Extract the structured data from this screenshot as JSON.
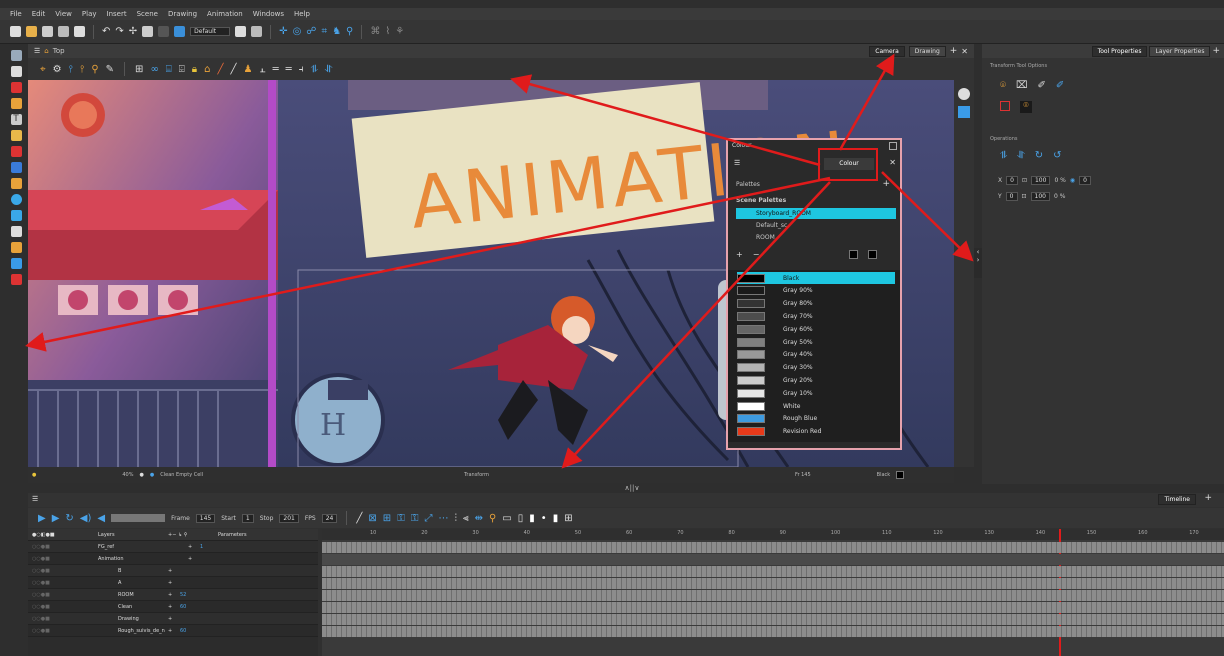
{
  "menu": [
    "File",
    "Edit",
    "View",
    "Play",
    "Insert",
    "Scene",
    "Drawing",
    "Animation",
    "Windows",
    "Help"
  ],
  "toolbar": {
    "workspace": "Default"
  },
  "camera_view": {
    "tabs": [
      "Camera",
      "Drawing"
    ],
    "scene_title": "Top",
    "sign_text": "ANIMATION",
    "status": {
      "zoom": "40%",
      "clean_empty_cell": "Clean Empty Cell",
      "tool": "Transform",
      "frame": "Fr 145",
      "color": "Black"
    }
  },
  "right_panel": {
    "tabs": [
      "Tool Properties",
      "Layer Properties"
    ],
    "section1": "Transform Tool Options",
    "section2": "Operations",
    "x_value": "0",
    "y_value": "0",
    "w_value": "100",
    "h_value": "100",
    "pct": "0 %",
    "angle": "0"
  },
  "colour_window": {
    "title": "Colour",
    "tab": "Colour",
    "palettes_label": "Palettes",
    "scene_palettes": "Scene Palettes",
    "palettes": [
      "Storyboard_ROOM",
      "Default_sc",
      "ROOM"
    ],
    "swatches": [
      {
        "name": "Black",
        "color": "#000000"
      },
      {
        "name": "Gray 90%",
        "color": "#1a1a1a"
      },
      {
        "name": "Gray 80%",
        "color": "#333333"
      },
      {
        "name": "Gray 70%",
        "color": "#4d4d4d"
      },
      {
        "name": "Gray 60%",
        "color": "#666666"
      },
      {
        "name": "Gray 50%",
        "color": "#808080"
      },
      {
        "name": "Gray 40%",
        "color": "#999999"
      },
      {
        "name": "Gray 30%",
        "color": "#b3b3b3"
      },
      {
        "name": "Gray 20%",
        "color": "#cccccc"
      },
      {
        "name": "Gray 10%",
        "color": "#e6e6e6"
      },
      {
        "name": "White",
        "color": "#ffffff"
      },
      {
        "name": "Rough Blue",
        "color": "#3e9be0"
      },
      {
        "name": "Revision Red",
        "color": "#e83a1a"
      }
    ]
  },
  "timeline": {
    "tab": "Timeline",
    "frame_label": "Frame",
    "frame": "145",
    "start_label": "Start",
    "start": "1",
    "stop_label": "Stop",
    "stop": "201",
    "fps_label": "FPS",
    "fps": "24",
    "layers_label": "Layers",
    "params_label": "Parameters",
    "layers": [
      {
        "name": "FG_ref",
        "value": "1"
      },
      {
        "name": "Animation",
        "value": ""
      },
      {
        "name": "B",
        "value": ""
      },
      {
        "name": "A",
        "value": ""
      },
      {
        "name": "ROOM",
        "value": "52"
      },
      {
        "name": "Clean",
        "value": "60"
      },
      {
        "name": "Drawing",
        "value": ""
      },
      {
        "name": "Rough_suivis_de_n",
        "value": "60"
      }
    ],
    "ruler": [
      "10",
      "20",
      "30",
      "40",
      "50",
      "60",
      "70",
      "80",
      "90",
      "100",
      "110",
      "120",
      "130",
      "140",
      "150",
      "160",
      "170"
    ]
  }
}
